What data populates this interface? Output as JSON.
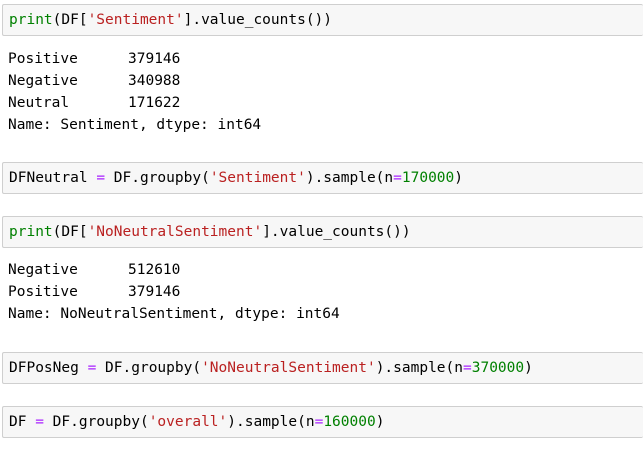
{
  "cells": [
    {
      "code": {
        "fn": "print",
        "p1": "(DF[",
        "str": "'Sentiment'",
        "p2": "].value_counts())"
      },
      "output": {
        "rows": [
          {
            "label": "Positive",
            "value": "379146"
          },
          {
            "label": "Negative",
            "value": "340988"
          },
          {
            "label": "Neutral",
            "value": "171622"
          }
        ],
        "footer": "Name: Sentiment, dtype: int64"
      }
    },
    {
      "code": {
        "p1": "DFNeutral ",
        "op1": "=",
        "p2": " DF.groupby(",
        "str": "'Sentiment'",
        "p3": ").sample(n",
        "op2": "=",
        "num": "170000",
        "p4": ")"
      }
    },
    {
      "code": {
        "fn": "print",
        "p1": "(DF[",
        "str": "'NoNeutralSentiment'",
        "p2": "].value_counts())"
      },
      "output": {
        "rows": [
          {
            "label": "Negative",
            "value": "512610"
          },
          {
            "label": "Positive",
            "value": "379146"
          }
        ],
        "footer": "Name: NoNeutralSentiment, dtype: int64"
      }
    },
    {
      "code": {
        "p1": "DFPosNeg ",
        "op1": "=",
        "p2": " DF.groupby(",
        "str": "'NoNeutralSentiment'",
        "p3": ").sample(n",
        "op2": "=",
        "num": "370000",
        "p4": ")"
      }
    },
    {
      "code": {
        "p1": "DF ",
        "op1": "=",
        "p2": " DF.groupby(",
        "str": "'overall'",
        "p3": ").sample(n",
        "op2": "=",
        "num": "160000",
        "p4": ")"
      }
    }
  ]
}
